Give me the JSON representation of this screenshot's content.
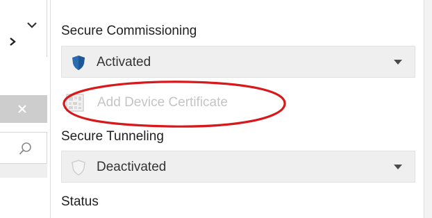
{
  "sections": {
    "secure_commissioning": {
      "label": "Secure Commissioning",
      "value": "Activated",
      "state_icon": "shield-icon-active"
    },
    "add_device_certificate": {
      "label": "Add Device Certificate",
      "enabled": false,
      "icon": "certificate-grid-icon"
    },
    "secure_tunneling": {
      "label": "Secure Tunneling",
      "value": "Deactivated",
      "state_icon": "shield-icon-inactive"
    },
    "status": {
      "label": "Status"
    }
  },
  "annotation": {
    "shape": "ellipse",
    "color": "#d7191c",
    "highlights": "add_device_certificate"
  },
  "colors": {
    "shield_active": "#2b6cb0",
    "disabled_text": "#c4c4c4",
    "dropdown_bg": "#efefef"
  }
}
